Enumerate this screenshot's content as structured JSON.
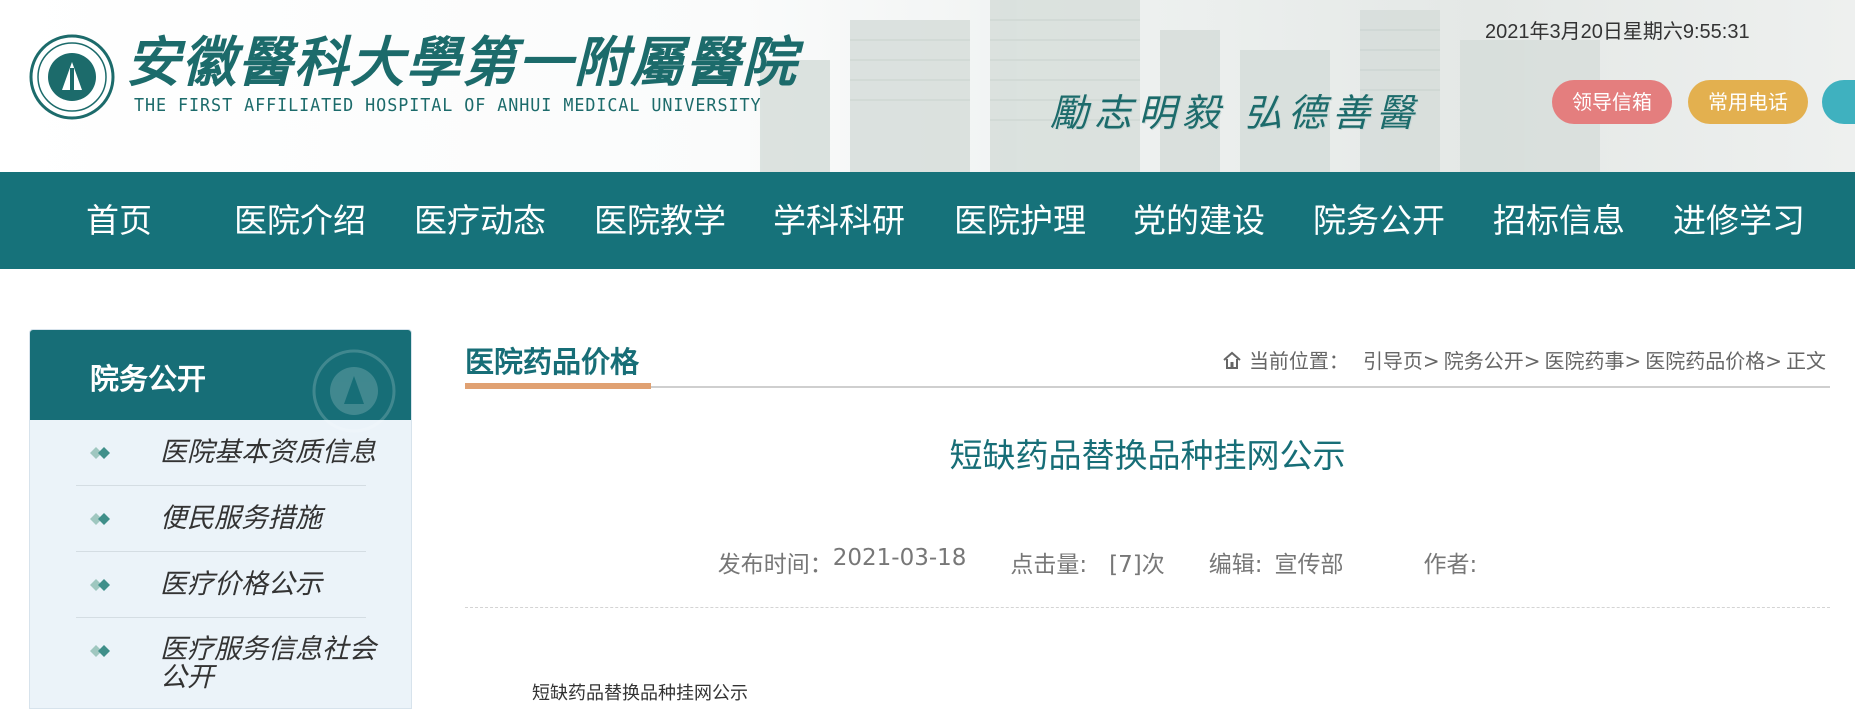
{
  "header": {
    "logo_cn": "安徽醫科大學第一附屬醫院",
    "logo_en": "THE FIRST AFFILIATED HOSPITAL OF ANHUI MEDICAL UNIVERSITY",
    "motto": "勵志明毅 弘德善醫",
    "datetime": "2021年3月20日星期六9:55:31",
    "buttons": [
      {
        "label": "领导信箱",
        "color": "#e47e7e"
      },
      {
        "label": "常用电话",
        "color": "#e3b04f"
      },
      {
        "label": "",
        "color": "#3fb1bf"
      }
    ]
  },
  "nav": {
    "items": [
      "首页",
      "医院介绍",
      "医疗动态",
      "医院教学",
      "学科科研",
      "医院护理",
      "党的建设",
      "院务公开",
      "招标信息",
      "进修学习"
    ]
  },
  "sidebar": {
    "title": "院务公开",
    "items": [
      "医院基本资质信息",
      "便民服务措施",
      "医疗价格公示",
      "医疗服务信息社会公开"
    ]
  },
  "main": {
    "section_title": "医院药品价格",
    "breadcrumb": {
      "prefix": "当前位置：",
      "items": [
        "引导页>",
        "院务公开>",
        "医院药事>",
        "医院药品价格>",
        "正文"
      ]
    },
    "article_title": "短缺药品替换品种挂网公示",
    "meta": {
      "publish_label": "发布时间：",
      "publish_date": "2021-03-18",
      "hits_label": "点击量:",
      "hits_value": "[7]次",
      "editor_label": "编辑:",
      "editor_value": "宣传部",
      "author_label": "作者:"
    },
    "body_first_line": "短缺药品替换品种挂网公示"
  },
  "colors": {
    "brand_teal": "#16727a",
    "accent_orange": "#e0a172",
    "sidebar_bg": "#ebf3f9"
  }
}
